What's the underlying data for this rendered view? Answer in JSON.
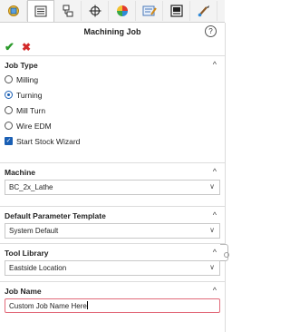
{
  "tabs": [
    {
      "icon": "feature-manager-icon"
    },
    {
      "icon": "property-manager-icon"
    },
    {
      "icon": "configuration-manager-icon"
    },
    {
      "icon": "dimxpert-icon"
    },
    {
      "icon": "display-manager-icon"
    },
    {
      "icon": "cam-feature-tree-icon"
    },
    {
      "icon": "cam-operation-tree-icon"
    },
    {
      "icon": "cam-toolpath-icon"
    }
  ],
  "header": {
    "title": "Machining Job",
    "help_icon": "help-icon"
  },
  "actions": {
    "ok": "✔",
    "cancel": "✖"
  },
  "job_type": {
    "title": "Job Type",
    "options": [
      "Milling",
      "Turning",
      "Mill Turn",
      "Wire EDM"
    ],
    "selected": "Turning",
    "checkbox_label": "Start Stock Wizard",
    "checkbox_checked": true
  },
  "machine": {
    "title": "Machine",
    "value": "BC_2x_Lathe"
  },
  "template": {
    "title": "Default Parameter Template",
    "value": "System Default"
  },
  "tool_library": {
    "title": "Tool Library",
    "value": "Eastside Location"
  },
  "job_name": {
    "title": "Job Name",
    "value": "Custom Job Name Here"
  },
  "colors": {
    "accent": "#1a5fb4",
    "ok": "#2b9a2b",
    "cancel": "#d32a2a",
    "focus_border": "#e26a7a"
  }
}
